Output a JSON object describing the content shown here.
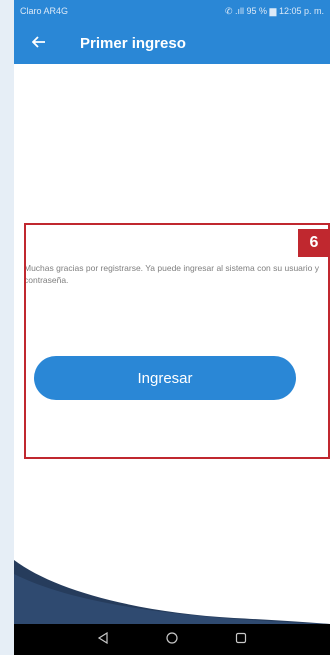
{
  "status_bar": {
    "time": "Claro AR4G",
    "right": "✆ .ıll 95 % ▆ 12:05 p. m."
  },
  "app_bar": {
    "back_icon": "arrow-left-icon",
    "title": "Primer ingreso"
  },
  "message": "Muchas gracias por registrarse. Ya puede ingresar al sistema con su usuario y contraseña.",
  "ingresar_button": "Ingresar",
  "annotation": {
    "step_number": "6",
    "color": "#c0282f"
  },
  "nav_bar": {
    "back_icon": "triangle-back-icon",
    "home_icon": "circle-home-icon",
    "recents_icon": "square-recents-icon"
  },
  "colors": {
    "primary": "#2a87d6",
    "wave_dark": "#263c5c"
  }
}
